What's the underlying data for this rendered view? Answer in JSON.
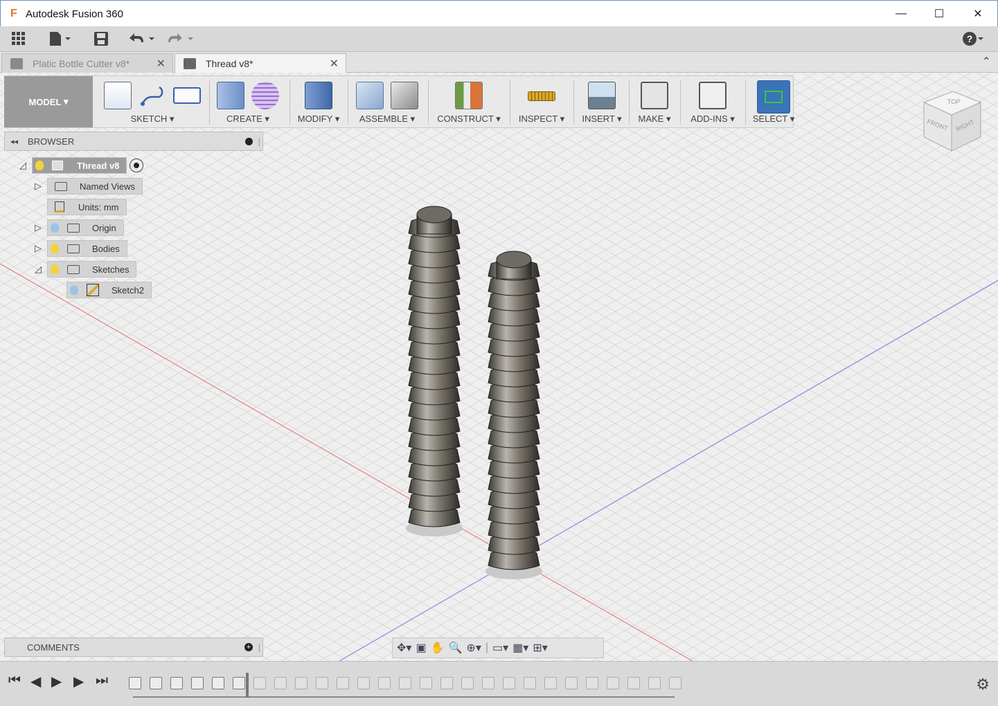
{
  "window": {
    "logo": "F",
    "title": "Autodesk Fusion 360",
    "minimize": "—",
    "maximize": "☐",
    "close": "✕"
  },
  "qat": {
    "grid_icon": "grid-icon",
    "file_icon": "file-icon",
    "save_icon": "save-icon",
    "undo_icon": "undo-icon",
    "redo_icon": "redo-icon",
    "help": "?"
  },
  "tabs": [
    {
      "label": "Platic Bottle Cutter v8*",
      "active": false
    },
    {
      "label": "Thread v8*",
      "active": true
    }
  ],
  "toolbar": {
    "workspace": "MODEL",
    "groups": [
      "SKETCH",
      "CREATE",
      "MODIFY",
      "ASSEMBLE",
      "CONSTRUCT",
      "INSPECT",
      "INSERT",
      "MAKE",
      "ADD-INS",
      "SELECT"
    ]
  },
  "browser": {
    "title": "BROWSER",
    "items": [
      {
        "label": "Thread v8",
        "level": 0
      },
      {
        "label": "Named Views",
        "level": 1
      },
      {
        "label": "Units: mm",
        "level": 1
      },
      {
        "label": "Origin",
        "level": 1
      },
      {
        "label": "Bodies",
        "level": 1
      },
      {
        "label": "Sketches",
        "level": 1
      },
      {
        "label": "Sketch2",
        "level": 2
      }
    ]
  },
  "viewcube": {
    "top": "TOP",
    "front": "FRONT",
    "right": "RIGHT"
  },
  "comments": {
    "title": "COMMENTS"
  },
  "colors": {
    "select_accent": "#3b73b9",
    "bulb": "#f3d33b",
    "bulb_off": "#9cc4e8"
  }
}
